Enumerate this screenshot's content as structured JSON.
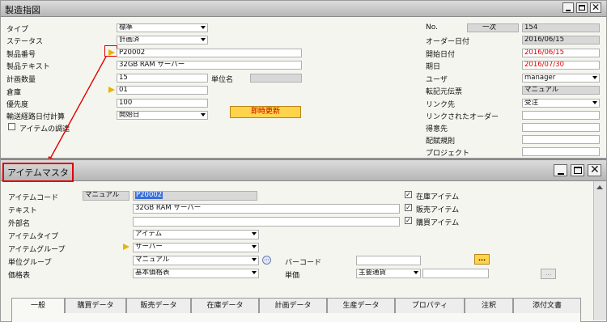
{
  "win1": {
    "title": "製造指図",
    "labels": {
      "type": "タイプ",
      "status": "ステータス",
      "product_no": "製品番号",
      "product_text": "製品テキスト",
      "planned_qty": "計画数量",
      "warehouse": "倉庫",
      "priority": "優先度",
      "routing": "輸送経路日付計算",
      "pick_items": "アイテムの調達",
      "unit_name": "単位名"
    },
    "values": {
      "type": "標準",
      "status": "計画済",
      "product_no": "P20002",
      "product_text": "32GB RAM サーバー",
      "planned_qty": "15",
      "unit_name": "",
      "warehouse": "01",
      "priority": "100",
      "routing": "開始日"
    },
    "update_button": "即時更新",
    "right": {
      "no_label": "No.",
      "no_series": "一次",
      "no_value": "154",
      "order_date_label": "オーダー日付",
      "order_date": "2016/06/15",
      "start_date_label": "開始日付",
      "start_date": "2016/06/15",
      "due_date_label": "期日",
      "due_date": "2016/07/30",
      "user_label": "ユーザ",
      "user": "manager",
      "origin_label": "転記元伝票",
      "origin": "マニュアル",
      "link_label": "リンク先",
      "link": "受注",
      "linked_order_label": "リンクされたオーダー",
      "linked_order": "",
      "customer_label": "得意先",
      "customer": "",
      "dist_rule_label": "配賦規則",
      "dist_rule": "",
      "project_label": "プロジェクト",
      "project": ""
    },
    "colors": {
      "accent_red": "#e00000",
      "button_yellow": "#ffd34a"
    }
  },
  "win2": {
    "title": "アイテムマスタ",
    "labels": {
      "item_code": "アイテムコード",
      "text": "テキスト",
      "foreign_name": "外部名",
      "item_type": "アイテムタイプ",
      "item_group": "アイテムグループ",
      "uom_group": "単位グループ",
      "price_list": "価格表",
      "barcode": "バーコード",
      "unit_price": "単価"
    },
    "values": {
      "numbering": "マニュアル",
      "item_code": "P20002",
      "text": "32GB RAM サーバー",
      "foreign_name": "",
      "item_type": "アイテム",
      "item_group": "サーバー",
      "uom_group": "マニュアル",
      "price_list": "基本価格表",
      "barcode": "",
      "currency": "主要通貨",
      "unit_price": ""
    },
    "checks": {
      "inventory": "在庫アイテム",
      "sales": "販売アイテム",
      "purchase": "購買アイテム"
    },
    "ellipsis": "...",
    "tabs": [
      "一般",
      "購買データ",
      "販売データ",
      "在庫データ",
      "計画データ",
      "生産データ",
      "プロパティ",
      "注釈",
      "添付文書"
    ]
  }
}
